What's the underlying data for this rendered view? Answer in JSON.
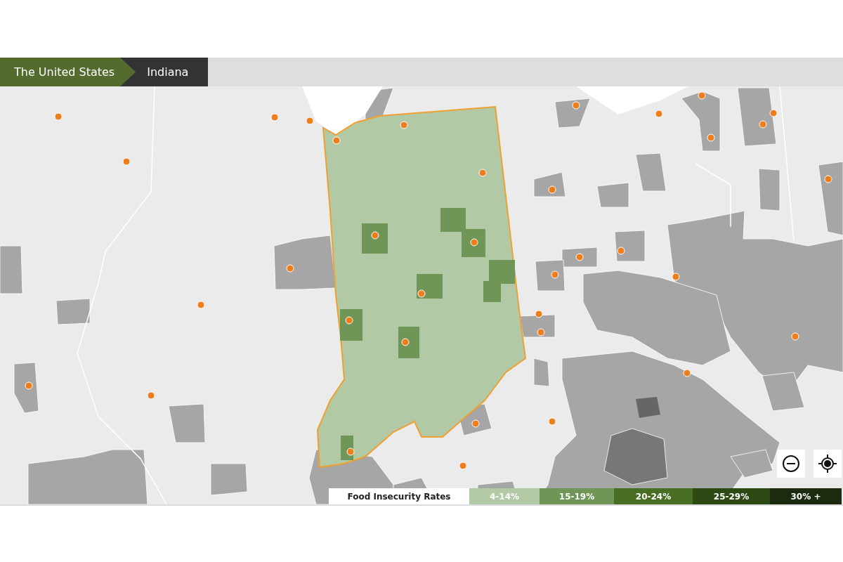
{
  "breadcrumbs": [
    {
      "label": "The United States",
      "selected": false
    },
    {
      "label": "Indiana",
      "selected": true
    }
  ],
  "legend": {
    "title": "Food Insecurity Rates",
    "items": [
      {
        "label": "4-14%",
        "color": "#b1c9a4"
      },
      {
        "label": "15-19%",
        "color": "#6f9657"
      },
      {
        "label": "20-24%",
        "color": "#486e24"
      },
      {
        "label": "25-29%",
        "color": "#2d4a14"
      },
      {
        "label": "30% +",
        "color": "#1c2a10"
      }
    ]
  }
}
